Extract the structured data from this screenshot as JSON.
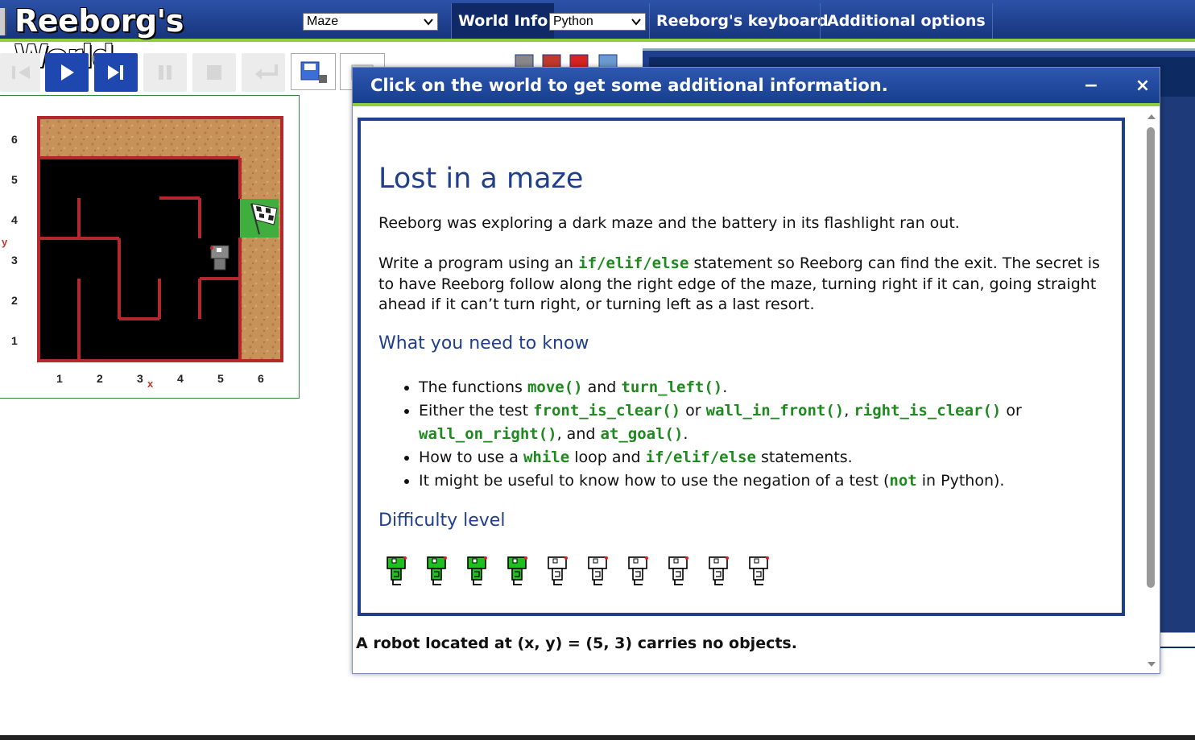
{
  "app": {
    "title": "Reeborg's World",
    "world_select": "Maze",
    "language_select": "Python",
    "nav": {
      "world_info": "World Info",
      "keyboard": "Reeborg's keyboard",
      "options": "Additional options"
    }
  },
  "toolbar": {
    "buttons": [
      "reload-icon",
      "run-icon",
      "step-icon",
      "pause-icon",
      "stop-icon",
      "return-icon",
      "save-icon",
      "open-icon"
    ]
  },
  "world": {
    "x_ticks": [
      "1",
      "2",
      "3",
      "4",
      "5",
      "6"
    ],
    "y_ticks": [
      "6",
      "5",
      "4",
      "3",
      "2",
      "1"
    ],
    "x_axis_letter": "x",
    "y_axis_letter": "y",
    "robot_position": [
      5,
      3
    ],
    "goal_position": [
      6,
      4
    ]
  },
  "dialog": {
    "title": "Click on the world to get some additional information.",
    "minimize": "−",
    "close": "×",
    "heading": "Lost in a maze",
    "intro": "Reeborg was exploring a dark maze and the battery in its flashlight ran out.",
    "prog_a": "Write a program using an ",
    "prog_code": "if/elif/else",
    "prog_b": " statement so Reeborg can find the exit. The secret is to have Reeborg follow along the right edge of the maze, turning right if it can, going straight ahead if it can’t turn right, or turning left as a last resort.",
    "know_heading": "What you need to know",
    "know": {
      "l1_a": "The functions ",
      "l1_c1": "move()",
      "l1_b": " and ",
      "l1_c2": "turn_left()",
      "l1_end": ".",
      "l2_a": "Either the test ",
      "l2_c1": "front_is_clear()",
      "l2_or1": " or ",
      "l2_c2": "wall_in_front()",
      "l2_comma": ", ",
      "l2_c3": "right_is_clear()",
      "l2_or2": " or ",
      "l2_c4": "wall_on_right()",
      "l2_and": ", and ",
      "l2_c5": "at_goal()",
      "l2_end": ".",
      "l3_a": "How to use a ",
      "l3_c1": "while",
      "l3_b": " loop and ",
      "l3_c2": "if/elif/else",
      "l3_c": " statements.",
      "l4_a": "It might be useful to know how to use the negation of a test (",
      "l4_c1": "not",
      "l4_b": " in Python)."
    },
    "difficulty_heading": "Difficulty level",
    "difficulty": 4,
    "difficulty_max": 10,
    "status": "A robot located at (x, y) = (5, 3) carries no objects."
  },
  "colors": {
    "header_blue": "#1f45a0",
    "accent_green": "#8fcf3c",
    "code_green": "#1e8a1e",
    "heading_blue": "#1f3f8c",
    "wall_red": "#b3282d"
  }
}
